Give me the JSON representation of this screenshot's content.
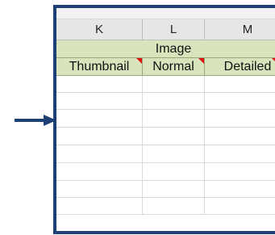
{
  "columns": [
    {
      "letter": "K"
    },
    {
      "letter": "L"
    },
    {
      "letter": "M"
    }
  ],
  "group_header": {
    "label": "Image"
  },
  "sub_headers": [
    {
      "label": "Thumbnail"
    },
    {
      "label": "Normal"
    },
    {
      "label": "Detailed"
    }
  ],
  "colors": {
    "frame": "#1f3f77",
    "arrow": "#1f3f77",
    "header_fill": "#d8e4bc",
    "comment_marker": "#e01010"
  }
}
